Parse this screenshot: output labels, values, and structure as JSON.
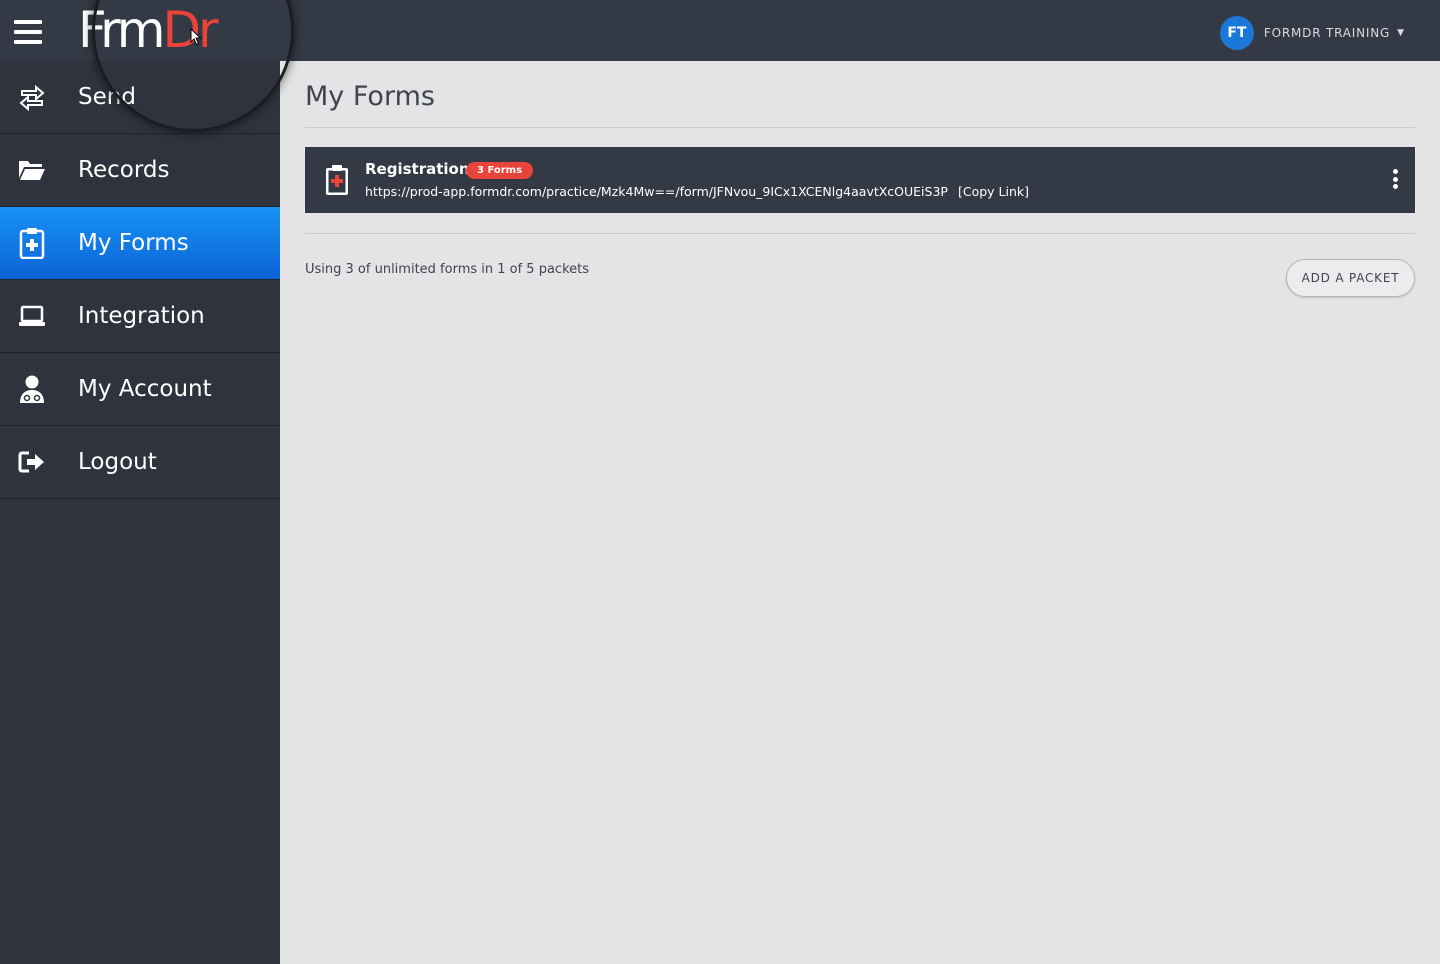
{
  "header": {
    "logo_part1": "Frm",
    "logo_part2": "Dr",
    "user_initials": "FT",
    "user_name": "FORMDR TRAINING",
    "user_caret": "▼"
  },
  "sidebar": {
    "items": [
      {
        "label": "Send",
        "icon": "send-arrows-icon"
      },
      {
        "label": "Records",
        "icon": "folder-open-icon"
      },
      {
        "label": "My Forms",
        "icon": "clipboard-plus-icon",
        "active": true
      },
      {
        "label": "Integration",
        "icon": "laptop-icon"
      },
      {
        "label": "My Account",
        "icon": "user-doctor-icon"
      },
      {
        "label": "Logout",
        "icon": "sign-out-icon"
      }
    ]
  },
  "main": {
    "title": "My Forms",
    "packet": {
      "name": "Registration",
      "badge": "3 Forms",
      "url": "https://prod-app.formdr.com/practice/Mzk4Mw==/form/JFNvou_9ICx1XCENlg4aavtXcOUEiS3P",
      "copy_link": "[Copy Link]"
    },
    "usage_text": "Using 3 of unlimited forms in 1 of 5 packets",
    "add_packet_label": "ADD A PACKET"
  },
  "colors": {
    "accent_blue": "#1993f5",
    "brand_red": "#e8443a",
    "dark_bar": "#343a45",
    "sidebar_bg": "#2e333d",
    "content_bg": "#e4e4e6"
  }
}
